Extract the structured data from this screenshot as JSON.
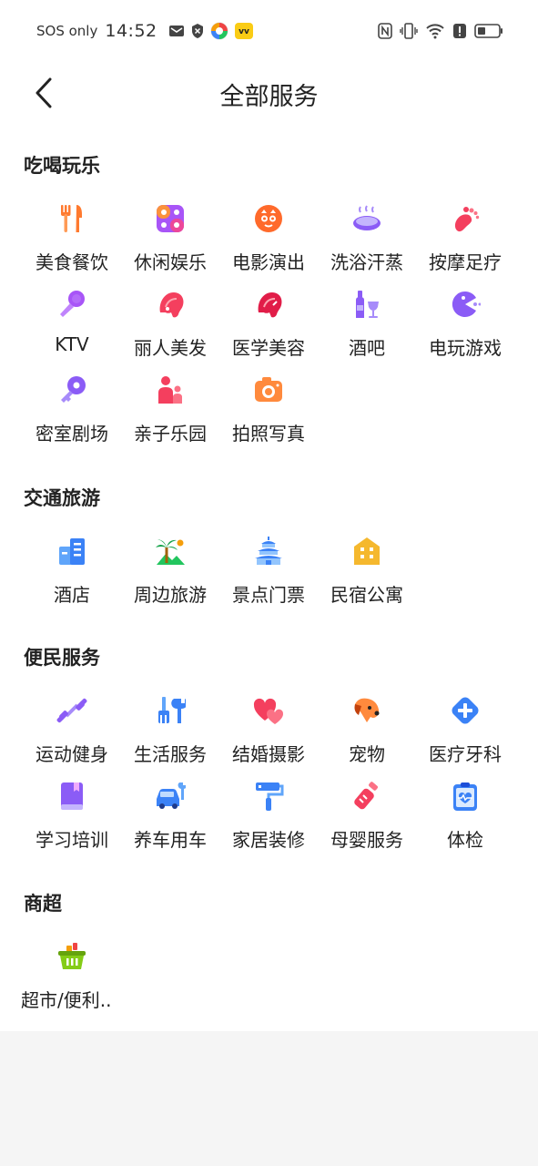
{
  "status_bar": {
    "carrier": "SOS only",
    "time": "14:52"
  },
  "header": {
    "title": "全部服务"
  },
  "sections": [
    {
      "title": "吃喝玩乐",
      "items": [
        {
          "label": "美食餐饮",
          "icon": "utensils-icon"
        },
        {
          "label": "休闲娱乐",
          "icon": "leisure-icon"
        },
        {
          "label": "电影演出",
          "icon": "cat-face-icon"
        },
        {
          "label": "洗浴汗蒸",
          "icon": "bath-icon"
        },
        {
          "label": "按摩足疗",
          "icon": "foot-icon"
        },
        {
          "label": "KTV",
          "icon": "microphone-icon"
        },
        {
          "label": "丽人美发",
          "icon": "hair-salon-icon"
        },
        {
          "label": "医学美容",
          "icon": "beauty-icon"
        },
        {
          "label": "酒吧",
          "icon": "wine-icon"
        },
        {
          "label": "电玩游戏",
          "icon": "game-icon"
        },
        {
          "label": "密室剧场",
          "icon": "key-icon"
        },
        {
          "label": "亲子乐园",
          "icon": "parent-child-icon"
        },
        {
          "label": "拍照写真",
          "icon": "camera-icon"
        }
      ]
    },
    {
      "title": "交通旅游",
      "items": [
        {
          "label": "酒店",
          "icon": "hotel-icon"
        },
        {
          "label": "周边旅游",
          "icon": "palm-tree-icon"
        },
        {
          "label": "景点门票",
          "icon": "temple-icon"
        },
        {
          "label": "民宿公寓",
          "icon": "house-icon"
        }
      ]
    },
    {
      "title": "便民服务",
      "items": [
        {
          "label": "运动健身",
          "icon": "dumbbell-icon"
        },
        {
          "label": "生活服务",
          "icon": "tools-icon"
        },
        {
          "label": "结婚摄影",
          "icon": "hearts-icon"
        },
        {
          "label": "宠物",
          "icon": "dog-icon"
        },
        {
          "label": "医疗牙科",
          "icon": "medical-icon"
        },
        {
          "label": "学习培训",
          "icon": "book-icon"
        },
        {
          "label": "养车用车",
          "icon": "car-repair-icon"
        },
        {
          "label": "家居装修",
          "icon": "paint-roller-icon"
        },
        {
          "label": "母婴服务",
          "icon": "baby-bottle-icon"
        },
        {
          "label": "体检",
          "icon": "clipboard-heart-icon"
        }
      ]
    },
    {
      "title": "商超",
      "items": [
        {
          "label": "超市/便利..",
          "icon": "basket-icon"
        }
      ]
    }
  ],
  "colors": {
    "purple": "#8b5cf6",
    "orange": "#ff7a2f",
    "pink": "#f43f5e",
    "blue": "#3b82f6",
    "green": "#84cc16",
    "yellow": "#f5b82e"
  }
}
